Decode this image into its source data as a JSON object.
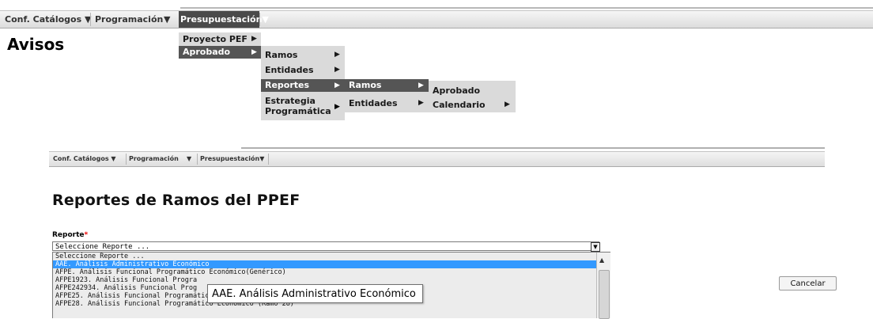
{
  "nav_top": {
    "items": [
      "Conf. Catálogos ▼",
      "Programación",
      "▼",
      "Presupuestación▼"
    ]
  },
  "page_title_1": "Avisos",
  "menus": {
    "presupuestacion": [
      "Proyecto PEF",
      "Aprobado"
    ],
    "aprobado": [
      "Ramos",
      "Entidades",
      "Reportes",
      "Estrategia Programática"
    ],
    "reportes": [
      "Ramos",
      "Entidades"
    ],
    "ramos": [
      "Aprobado",
      "Calendario"
    ],
    "arrow_glyph": "▶"
  },
  "nav_bottom": {
    "items": [
      "Conf. Catálogos ▼",
      "Programación",
      "▼",
      "Presupuestación▼"
    ]
  },
  "page_title_2": "Reportes de Ramos del PPEF",
  "form": {
    "label": "Reporte",
    "required_mark": "*",
    "selected_value": "Seleccione Reporte ...",
    "dropdown_glyph": "▼",
    "options": [
      "Seleccione Reporte ...",
      "AAE. Análisis Administrativo Económico",
      "AFPE. Análisis Funcional Programático Económico(Genérico)",
      "AFPE1923. Análisis Funcional Progra",
      "AFPE242934. Análisis Funcional Prog",
      "AFPE25. Análisis Funcional Programático Económico (Ramo 25)",
      "AFPE28. Análisis Funcional Programático Económico (Ramo 28)"
    ],
    "highlighted_index": 1,
    "scroll_up_glyph": "▲",
    "tooltip": "AAE. Análisis Administrativo Económico",
    "cancel_label": "Cancelar"
  }
}
